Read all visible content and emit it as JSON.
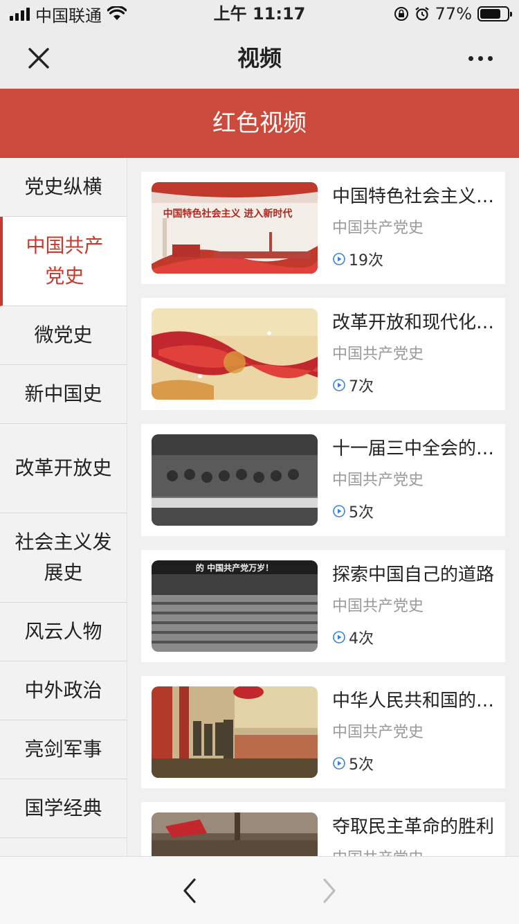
{
  "status_bar": {
    "carrier": "中国联通",
    "time": "上午 11:17",
    "battery": "77%",
    "battery_level": 0.77
  },
  "nav": {
    "title": "视频"
  },
  "banner": {
    "title": "红色视频"
  },
  "sidebar": {
    "items": [
      {
        "label": "党史纵横"
      },
      {
        "label": "中国共产党史"
      },
      {
        "label": "微党史"
      },
      {
        "label": "新中国史"
      },
      {
        "label": "改革开放史"
      },
      {
        "label": "社会主义发展史"
      },
      {
        "label": "风云人物"
      },
      {
        "label": "中外政治"
      },
      {
        "label": "亮剑军事"
      },
      {
        "label": "国学经典"
      }
    ]
  },
  "videos": [
    {
      "title": "中国特色社会主义进入新时代",
      "category": "中国共产党史",
      "views": "19次",
      "thumb_text": "中国特色社会主义 进入新时代"
    },
    {
      "title": "改革开放和现代化建设",
      "category": "中国共产党史",
      "views": "7次"
    },
    {
      "title": "十一届三中全会的召开",
      "category": "中国共产党史",
      "views": "5次"
    },
    {
      "title": "探索中国自己的道路",
      "category": "中国共产党史",
      "views": "4次",
      "thumb_text": "的 中国共产党万岁！"
    },
    {
      "title": "中华人民共和国的成立",
      "category": "中国共产党史",
      "views": "5次"
    },
    {
      "title": "夺取民主革命的胜利",
      "category": "中国共产党史",
      "views": ""
    }
  ]
}
